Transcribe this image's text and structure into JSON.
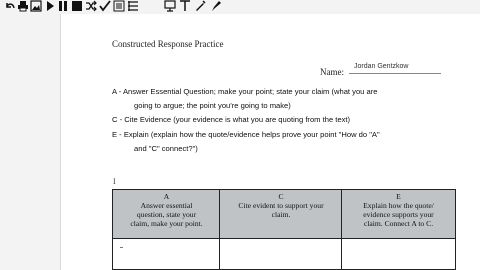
{
  "toolbar": {
    "tools": [
      {
        "name": "undo-icon",
        "glyph": "↶"
      },
      {
        "name": "print-icon",
        "glyph": "⎙"
      },
      {
        "name": "image-icon",
        "glyph": "▣"
      },
      {
        "name": "play-icon",
        "glyph": "▶"
      },
      {
        "name": "pause-icon",
        "glyph": "❚❚"
      },
      {
        "name": "stop-icon",
        "glyph": "■"
      },
      {
        "name": "shuffle-icon",
        "glyph": "⤨"
      },
      {
        "name": "check-icon",
        "glyph": "✓"
      },
      {
        "name": "list-icon",
        "glyph": "≡"
      },
      {
        "name": "monitor-icon",
        "glyph": "▭"
      },
      {
        "name": "pin-icon",
        "glyph": "⊥"
      },
      {
        "name": "pencil-icon",
        "glyph": "✎"
      },
      {
        "name": "pen-icon",
        "glyph": "✒"
      }
    ]
  },
  "document": {
    "title": "Constructed Response Practice",
    "name_label": "Name:",
    "name_value": "Jordan Gentzkow",
    "instructions": {
      "a_line1": "A  -  Answer  Essential  Question;  make  your  point;  state  your  claim  (what  you  are",
      "a_line2": "going  to  argue;  the  point  you're  going  to  make)",
      "c_line": "C  -  Cite  Evidence  (your  evidence  is  what  you  are  quoting  from  the  text)",
      "e_line1": "E  -  Explain  (explain  how  the  quote/evidence  helps  prove  your  point  \"How  do  \"A\"",
      "e_line2": "and     \"C\"  connect?\")"
    },
    "cursor_mark": "I",
    "table": {
      "headers": [
        {
          "letter": "A",
          "line1": "Answer essential",
          "line2": "question, state your",
          "line3": "claim, make your point."
        },
        {
          "letter": "C",
          "line1": "Cite evident to support your",
          "line2": "claim.",
          "line3": ""
        },
        {
          "letter": "E",
          "line1": "Explain how the quote/",
          "line2": "evidence supports your",
          "line3": "claim. Connect A to C."
        }
      ]
    }
  }
}
